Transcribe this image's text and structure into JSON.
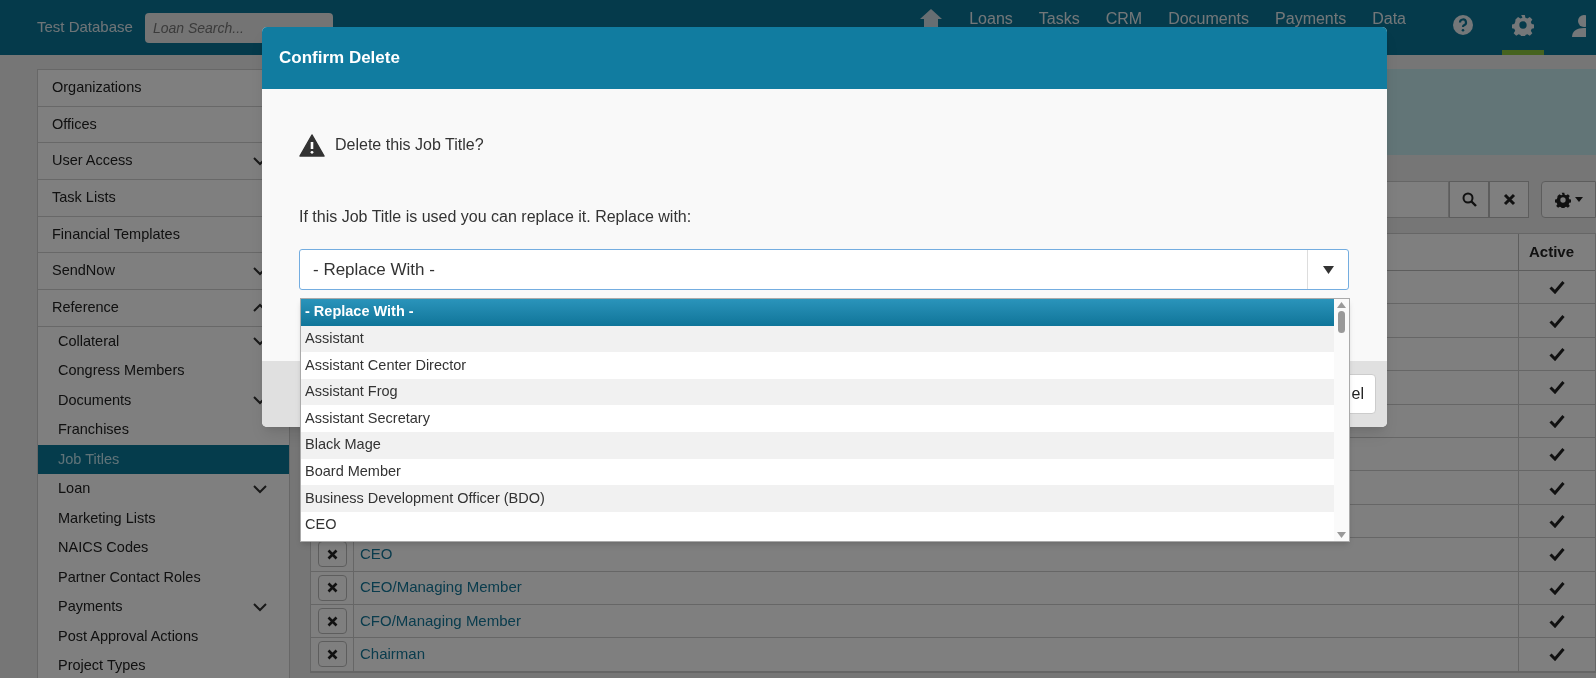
{
  "top_bar": {
    "title": "Test Database",
    "search": {
      "placeholder": "Loan Search..."
    },
    "nav": [
      {
        "label": "Loans"
      },
      {
        "label": "Tasks"
      },
      {
        "label": "CRM"
      },
      {
        "label": "Documents"
      },
      {
        "label": "Payments"
      },
      {
        "label": "Data"
      }
    ],
    "icons": [
      {
        "kind": "help",
        "selected": false
      },
      {
        "kind": "settings",
        "selected": true
      },
      {
        "kind": "user",
        "selected": false
      }
    ]
  },
  "sidebar": {
    "items": [
      {
        "label": "Organizations",
        "selected": false
      },
      {
        "label": "Offices",
        "selected": false
      },
      {
        "label": "User Access",
        "selected": false,
        "expanded": false
      },
      {
        "label": "Task Lists",
        "selected": false
      },
      {
        "label": "Financial Templates",
        "selected": false
      },
      {
        "label": "SendNow",
        "selected": false,
        "expanded": false
      },
      {
        "label": "Reference",
        "selected": false,
        "expanded": true,
        "children": [
          {
            "label": "Collateral",
            "selected": false,
            "expanded": false
          },
          {
            "label": "Congress Members",
            "selected": false
          },
          {
            "label": "Documents",
            "selected": false,
            "expanded": false
          },
          {
            "label": "Franchises",
            "selected": false
          },
          {
            "label": "Job Titles",
            "selected": true
          },
          {
            "label": "Loan",
            "selected": false,
            "expanded": false
          },
          {
            "label": "Marketing Lists",
            "selected": false
          },
          {
            "label": "NAICS Codes",
            "selected": false
          },
          {
            "label": "Partner Contact Roles",
            "selected": false
          },
          {
            "label": "Payments",
            "selected": false,
            "expanded": false
          },
          {
            "label": "Post Approval Actions",
            "selected": false
          },
          {
            "label": "Project Types",
            "selected": false
          }
        ]
      }
    ]
  },
  "table": {
    "columns": [
      {
        "label": "Active"
      }
    ],
    "rows": [
      {
        "active": true
      },
      {
        "active": true
      },
      {
        "active": true
      },
      {
        "active": true
      },
      {
        "active": true
      },
      {
        "active": true
      },
      {
        "active": true
      },
      {
        "active": true
      },
      {
        "name": "CEO",
        "active": true
      },
      {
        "name": "CEO/Managing Member",
        "active": true
      },
      {
        "name": "CFO/Managing Member",
        "active": true
      },
      {
        "name": "Chairman",
        "active": true
      }
    ]
  },
  "modal": {
    "title": "Confirm Delete",
    "warning": "Delete this Job Title?",
    "prompt": "If this Job Title is used you can replace it. Replace with:",
    "select": {
      "value": "- Replace With -",
      "options": [
        {
          "label": "- Replace With -",
          "selected": true
        },
        {
          "label": "Assistant",
          "selected": false
        },
        {
          "label": "Assistant Center Director",
          "selected": false
        },
        {
          "label": "Assistant Frog",
          "selected": false
        },
        {
          "label": "Assistant Secretary",
          "selected": false
        },
        {
          "label": "Black Mage",
          "selected": false
        },
        {
          "label": "Board Member",
          "selected": false
        },
        {
          "label": "Business Development Officer (BDO)",
          "selected": false
        },
        {
          "label": "CEO",
          "selected": false
        }
      ]
    },
    "footer_button": "el"
  }
}
